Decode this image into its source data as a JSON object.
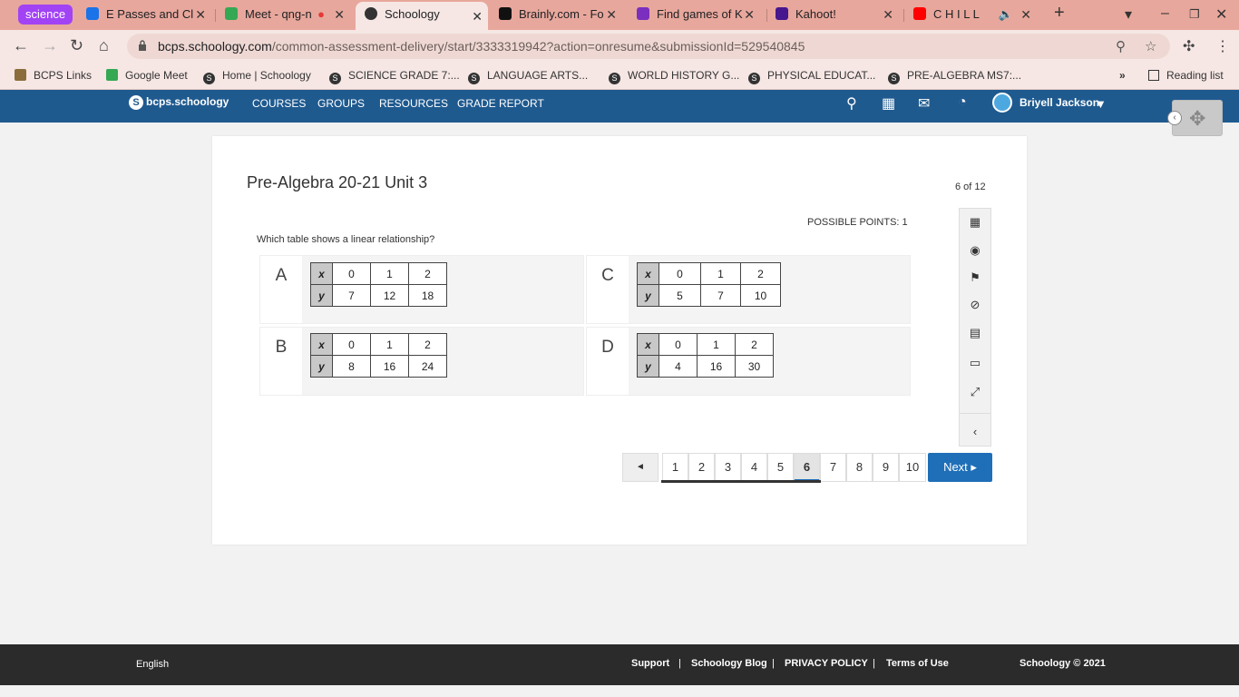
{
  "browser": {
    "tab_group": "science",
    "tabs": [
      {
        "title": "E Passes and Cl",
        "color": "#1a73e8"
      },
      {
        "title": "Meet - qng-n",
        "color": "#34a853"
      },
      {
        "title": "Schoology",
        "color": "#333333"
      },
      {
        "title": "Brainly.com - Fo",
        "color": "#111111"
      },
      {
        "title": "Find games of K",
        "color": "#7b2fbe"
      },
      {
        "title": "Kahoot!",
        "color": "#46178f"
      },
      {
        "title": "C H I L L",
        "color": "#ff0000"
      }
    ],
    "url_host": "bcps.schoology.com",
    "url_path": "/common-assessment-delivery/start/3333319942?action=onresume&submissionId=529540845",
    "bookmarks": [
      "BCPS Links",
      "Google Meet",
      "Home | Schoology",
      "SCIENCE GRADE 7:...",
      "LANGUAGE ARTS...",
      "WORLD HISTORY G...",
      "PHYSICAL EDUCAT...",
      "PRE-ALGEBRA MS7:..."
    ],
    "reading_list": "Reading list"
  },
  "header": {
    "logo": "bcps.schoology",
    "nav": [
      "COURSES",
      "GROUPS",
      "RESOURCES",
      "GRADE REPORT"
    ],
    "user": "Briyell Jackson"
  },
  "assessment": {
    "title": "Pre-Algebra 20-21 Unit 3",
    "progress": "6 of 12",
    "points": "POSSIBLE POINTS: 1",
    "question": "Which table shows a linear relationship?",
    "choices": [
      {
        "letter": "A",
        "x": [
          "0",
          "1",
          "2"
        ],
        "y": [
          "7",
          "12",
          "18"
        ]
      },
      {
        "letter": "B",
        "x": [
          "0",
          "1",
          "2"
        ],
        "y": [
          "8",
          "16",
          "24"
        ]
      },
      {
        "letter": "C",
        "x": [
          "0",
          "1",
          "2"
        ],
        "y": [
          "5",
          "7",
          "10"
        ]
      },
      {
        "letter": "D",
        "x": [
          "0",
          "1",
          "2"
        ],
        "y": [
          "4",
          "16",
          "30"
        ]
      }
    ],
    "row_x": "x",
    "row_y": "y"
  },
  "pager": {
    "prev": "◄",
    "pages": [
      "1",
      "2",
      "3",
      "4",
      "5",
      "6",
      "7",
      "8",
      "9",
      "10"
    ],
    "current": "6",
    "next": "Next ▸"
  },
  "footer": {
    "language": "English",
    "links": [
      "Support",
      "Schoology Blog",
      "PRIVACY POLICY",
      "Terms of Use"
    ],
    "copyright": "Schoology © 2021"
  }
}
